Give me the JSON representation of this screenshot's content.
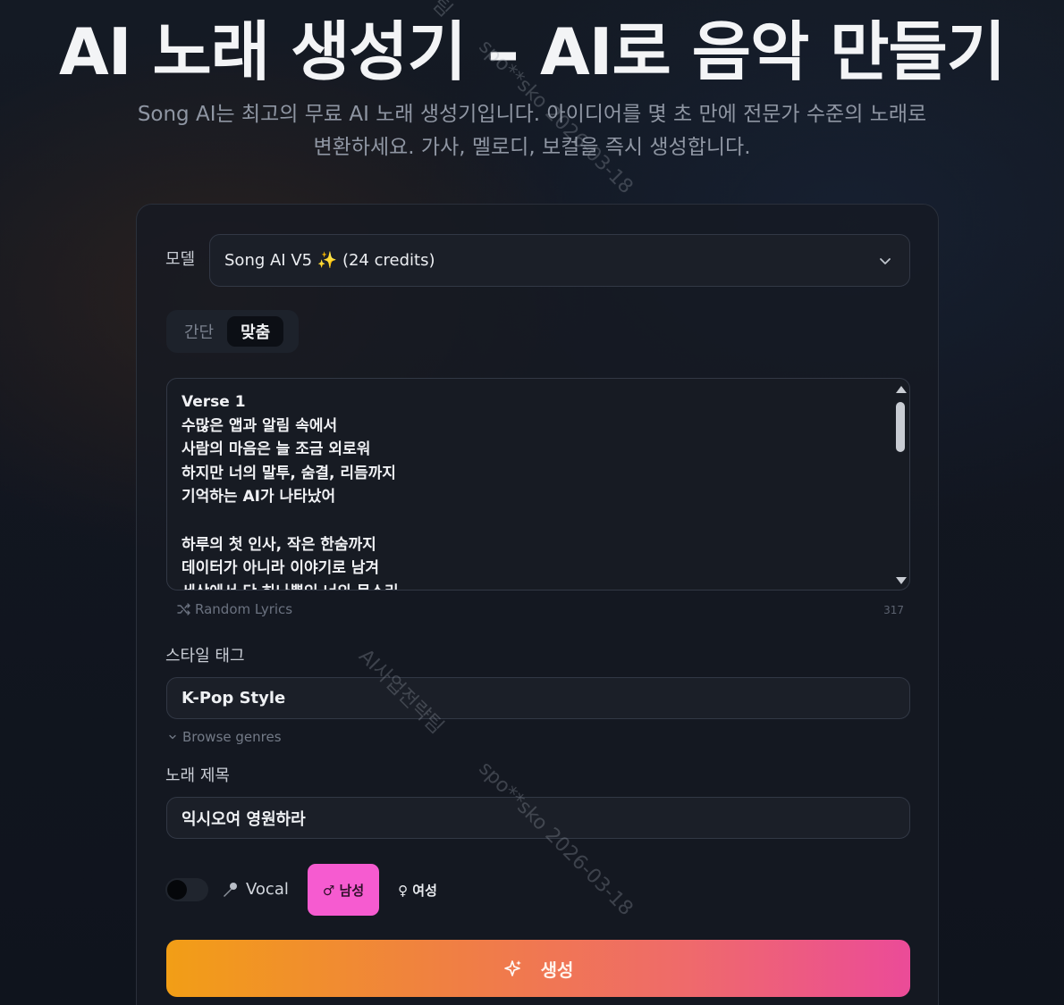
{
  "hero": {
    "title": "AI 노래 생성기 – AI로 음악 만들기",
    "subtitle": "Song AI는 최고의 무료 AI 노래 생성기입니다. 아이디어를 몇 초 만에 전문가 수준의 노래로 변환하세요. 가사, 멜로디, 보컬을 즉시 생성합니다."
  },
  "model": {
    "label": "모델",
    "selected": "Song AI V5 ✨ (24 credits)"
  },
  "mode_tabs": [
    {
      "label": "간단",
      "active": false
    },
    {
      "label": "맞춤",
      "active": true
    }
  ],
  "lyrics": {
    "text": "Verse 1\n수많은 앱과 알림 속에서\n사람의 마음은 늘 조금 외로워\n하지만 너의 말투, 숨결, 리듬까지\n기억하는 AI가 나타났어\n\n하루의 첫 인사, 작은 한숨까지\n데이터가 아니라 이야기로 남겨\n세상에서 단 하나뿐인 너의 목소리",
    "random_label": "Random Lyrics",
    "char_count": "317"
  },
  "style": {
    "label": "스타일 태그",
    "value": "K-Pop Style",
    "browse_label": "Browse genres"
  },
  "song_title": {
    "label": "노래 제목",
    "value": "익시오여 영원하라"
  },
  "vocal": {
    "label": "Vocal",
    "enabled": false,
    "male_label": "♂ 남성",
    "female_label": "♀ 여성",
    "selected": "male"
  },
  "generate": {
    "label": "생성"
  },
  "watermarks": [
    "팀",
    "spo**sko 2026-03-18",
    "AI사업전략팀",
    "spo**sko 2026-03-18"
  ],
  "colors": {
    "accent_pink": "#f65bd0",
    "gradient_start": "#f29e16",
    "gradient_end": "#eb4b98",
    "background": "#121620"
  }
}
